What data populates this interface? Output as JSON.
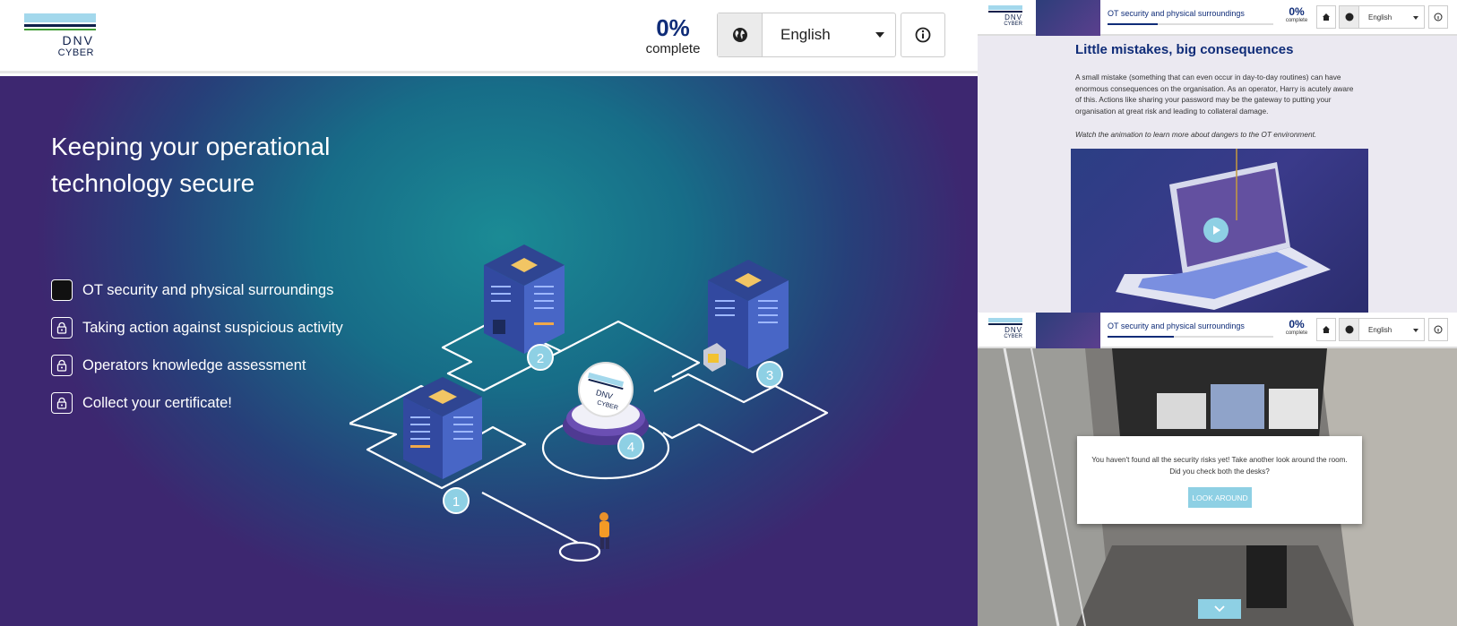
{
  "main": {
    "logo": {
      "line1": "DNV",
      "line2": "CYBER"
    },
    "progress": {
      "percent": "0%",
      "label": "complete"
    },
    "language": {
      "selected": "English"
    },
    "hero": {
      "title": "Keeping your operational technology secure",
      "modules": [
        {
          "label": "OT security and physical surroundings",
          "state": "current"
        },
        {
          "label": "Taking action against suspicious activity",
          "state": "locked"
        },
        {
          "label": "Operators knowledge assessment",
          "state": "locked"
        },
        {
          "label": "Collect your certificate!",
          "state": "locked"
        }
      ],
      "scene_markers": [
        "1",
        "2",
        "3",
        "4"
      ],
      "badge": {
        "line1": "DNV",
        "line2": "CYBER"
      }
    },
    "icons": [
      "globe-icon",
      "info-icon",
      "lock-icon",
      "caret-down-icon"
    ]
  },
  "panel_a": {
    "header": {
      "logo_line1": "DNV",
      "logo_line2": "CYBER",
      "course": "OT security and physical surroundings",
      "percent": "0%",
      "percent_label": "complete",
      "language": "English"
    },
    "title": "Little mistakes, big consequences",
    "body": "A small mistake (something that can even occur in day-to-day routines) can have enormous consequences on the organisation. As an operator, Harry is acutely aware of this. Actions like sharing your password may be the gateway to putting your organisation at great risk and leading to collateral damage.",
    "hint": "Watch the animation to learn more about dangers to the OT environment."
  },
  "panel_b": {
    "header": {
      "logo_line1": "DNV",
      "logo_line2": "CYBER",
      "course": "OT security and physical surroundings",
      "percent": "0%",
      "percent_label": "complete",
      "language": "English"
    },
    "dialog": {
      "message": "You haven't found all the security risks yet! Take another look around the room. Did you check both the desks?",
      "button": "LOOK AROUND"
    }
  },
  "colors": {
    "brand_navy": "#0f2c78",
    "logo_light_blue": "#a3d8ec",
    "marker_blue": "#8ed0e4",
    "hero_teal": "#1b8b95",
    "hero_purple": "#3d2770"
  }
}
